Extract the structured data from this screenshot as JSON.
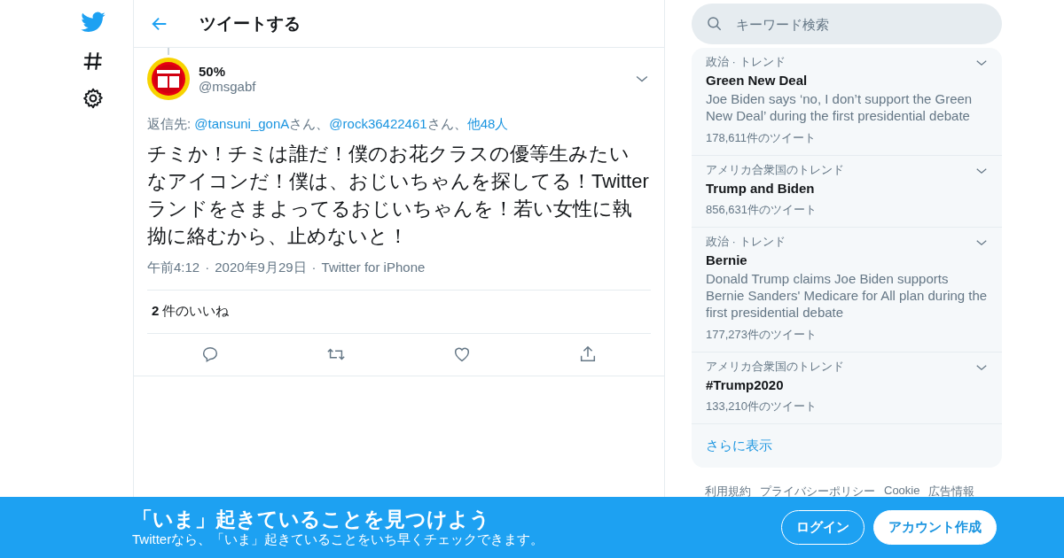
{
  "header": {
    "title": "ツイートする"
  },
  "tweet": {
    "display_name": "50%",
    "handle": "@msgabf",
    "reply_to": [
      {
        "kind": "plain",
        "text": "返信先: "
      },
      {
        "kind": "link",
        "text": "@tansuni_gonA"
      },
      {
        "kind": "plain",
        "text": "さん、"
      },
      {
        "kind": "link",
        "text": "@rock36422461"
      },
      {
        "kind": "plain",
        "text": "さん、"
      },
      {
        "kind": "link",
        "text": "他48人"
      }
    ],
    "text": "チミか！チミは誰だ！僕のお花クラスの優等生みたいなアイコンだ！僕は、おじいちゃんを探してる！Twitterランドをさまよってるおじいちゃんを！若い女性に執拗に絡むから、止めないと！",
    "meta": [
      "午前4:12",
      "2020年9月29日",
      "Twitter for iPhone"
    ],
    "meta_separator": "·",
    "likes_count": "2",
    "likes_label": "件のいいね"
  },
  "search": {
    "placeholder": "キーワード検索"
  },
  "trends": [
    {
      "category": "政治 · トレンド",
      "title": "Green New Deal",
      "description": "Joe Biden says ‘no, I don’t support the Green New Deal’ during the first presidential debate",
      "count": "178,611件のツイート"
    },
    {
      "category": "アメリカ合衆国のトレンド",
      "title": "Trump and Biden",
      "count": "856,631件のツイート"
    },
    {
      "category": "政治 · トレンド",
      "title": "Bernie",
      "description": "Donald Trump claims Joe Biden supports Bernie Sanders' Medicare for All plan during the first presidential debate",
      "count": "177,273件のツイート"
    },
    {
      "category": "アメリカ合衆国のトレンド",
      "title": "#Trump2020",
      "count": "133,210件のツイート"
    }
  ],
  "show_more": "さらに表示",
  "footer_links": [
    "利用規約",
    "プライバシーポリシー",
    "Cookie",
    "広告情報"
  ],
  "banner": {
    "title": "「いま」起きていることを見つけよう",
    "subtitle": "Twitterなら、「いま」起きていることをいち早くチェックできます。",
    "buttons": [
      {
        "kind": "outline",
        "label": "ログイン"
      },
      {
        "kind": "filled",
        "label": "アカウント作成"
      }
    ]
  }
}
